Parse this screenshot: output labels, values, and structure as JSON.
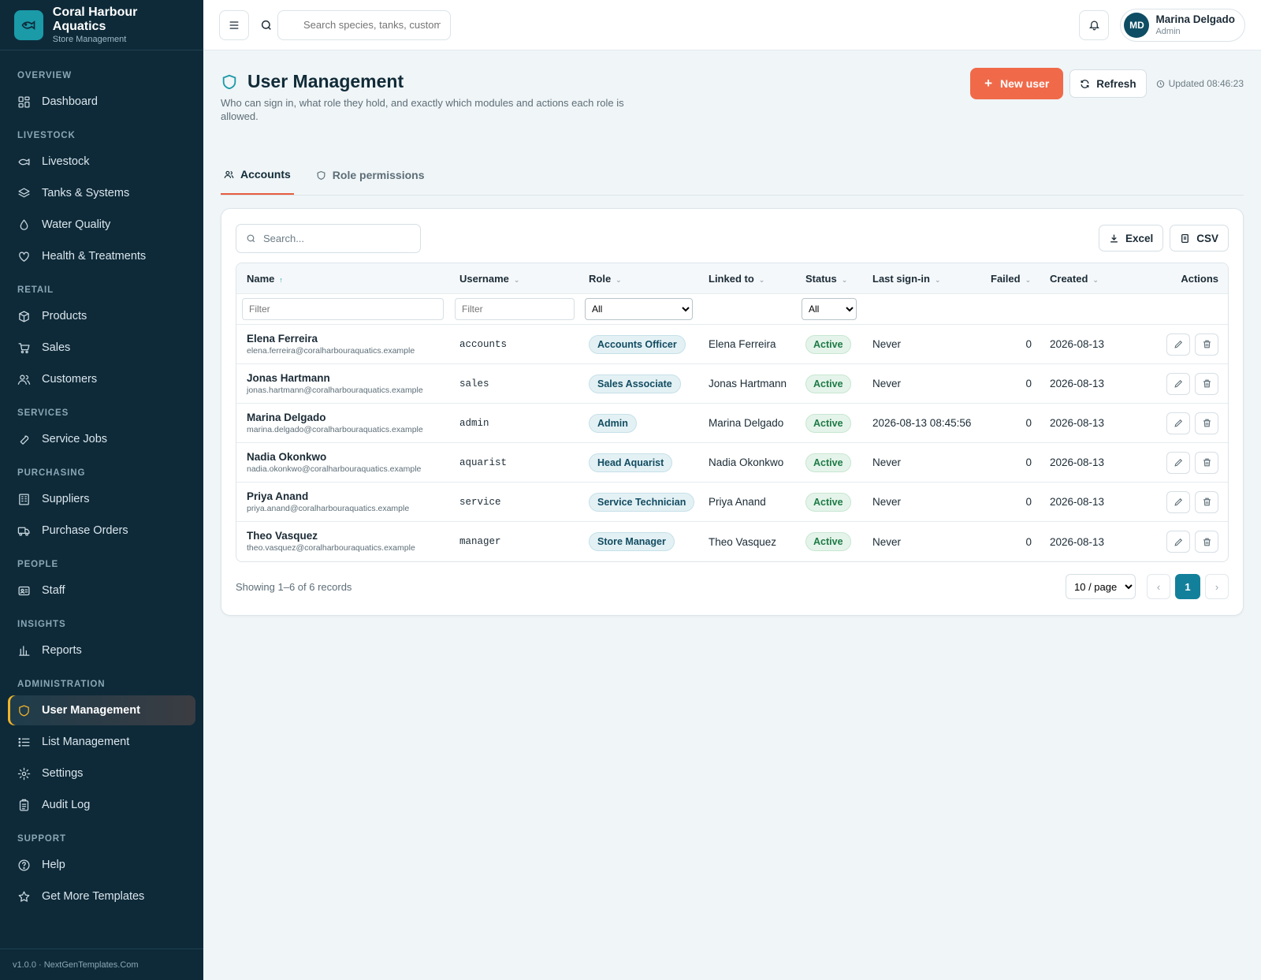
{
  "brand": {
    "title": "Coral Harbour Aquatics",
    "subtitle": "Store Management"
  },
  "sidebar": {
    "sections": [
      {
        "label": "OVERVIEW",
        "items": [
          {
            "label": "Dashboard",
            "icon": "dashboard-icon"
          }
        ]
      },
      {
        "label": "LIVESTOCK",
        "items": [
          {
            "label": "Livestock",
            "icon": "fish-icon"
          },
          {
            "label": "Tanks & Systems",
            "icon": "layers-icon"
          },
          {
            "label": "Water Quality",
            "icon": "droplet-icon"
          },
          {
            "label": "Health & Treatments",
            "icon": "heart-icon"
          }
        ]
      },
      {
        "label": "RETAIL",
        "items": [
          {
            "label": "Products",
            "icon": "box-icon"
          },
          {
            "label": "Sales",
            "icon": "cart-icon"
          },
          {
            "label": "Customers",
            "icon": "users-icon"
          }
        ]
      },
      {
        "label": "SERVICES",
        "items": [
          {
            "label": "Service Jobs",
            "icon": "wrench-icon"
          }
        ]
      },
      {
        "label": "PURCHASING",
        "items": [
          {
            "label": "Suppliers",
            "icon": "building-icon"
          },
          {
            "label": "Purchase Orders",
            "icon": "truck-icon"
          }
        ]
      },
      {
        "label": "PEOPLE",
        "items": [
          {
            "label": "Staff",
            "icon": "id-card-icon"
          }
        ]
      },
      {
        "label": "INSIGHTS",
        "items": [
          {
            "label": "Reports",
            "icon": "bar-chart-icon"
          }
        ]
      },
      {
        "label": "ADMINISTRATION",
        "items": [
          {
            "label": "User Management",
            "icon": "shield-icon",
            "active": true
          },
          {
            "label": "List Management",
            "icon": "list-icon"
          },
          {
            "label": "Settings",
            "icon": "gear-icon"
          },
          {
            "label": "Audit Log",
            "icon": "clipboard-icon"
          }
        ]
      },
      {
        "label": "SUPPORT",
        "items": [
          {
            "label": "Help",
            "icon": "help-icon"
          },
          {
            "label": "Get More Templates",
            "icon": "star-icon"
          }
        ]
      }
    ],
    "footer": "v1.0.0 · NextGenTemplates.Com"
  },
  "topbar": {
    "search_placeholder": "Search species, tanks, customers...",
    "user": {
      "initials": "MD",
      "name": "Marina Delgado",
      "role": "Admin"
    }
  },
  "page": {
    "title": "User Management",
    "description": "Who can sign in, what role they hold, and exactly which modules and actions each role is allowed.",
    "new_user": "New user",
    "refresh": "Refresh",
    "updated": "Updated 08:46:23"
  },
  "tabs": [
    {
      "label": "Accounts",
      "active": true
    },
    {
      "label": "Role permissions",
      "active": false
    }
  ],
  "table": {
    "search_placeholder": "Search...",
    "excel": "Excel",
    "csv": "CSV",
    "headers": {
      "name": "Name",
      "username": "Username",
      "role": "Role",
      "linked": "Linked to",
      "status": "Status",
      "last_signin": "Last sign-in",
      "failed": "Failed",
      "created": "Created",
      "actions": "Actions"
    },
    "filter_placeholder": "Filter",
    "filter_all": "All",
    "rows": [
      {
        "name": "Elena Ferreira",
        "email": "elena.ferreira@coralharbouraquatics.example",
        "username": "accounts",
        "role": "Accounts Officer",
        "linked": "Elena Ferreira",
        "status": "Active",
        "last_signin": "Never",
        "failed": "0",
        "created": "2026-08-13"
      },
      {
        "name": "Jonas Hartmann",
        "email": "jonas.hartmann@coralharbouraquatics.example",
        "username": "sales",
        "role": "Sales Associate",
        "linked": "Jonas Hartmann",
        "status": "Active",
        "last_signin": "Never",
        "failed": "0",
        "created": "2026-08-13"
      },
      {
        "name": "Marina Delgado",
        "email": "marina.delgado@coralharbouraquatics.example",
        "username": "admin",
        "role": "Admin",
        "linked": "Marina Delgado",
        "status": "Active",
        "last_signin": "2026-08-13 08:45:56",
        "failed": "0",
        "created": "2026-08-13"
      },
      {
        "name": "Nadia Okonkwo",
        "email": "nadia.okonkwo@coralharbouraquatics.example",
        "username": "aquarist",
        "role": "Head Aquarist",
        "linked": "Nadia Okonkwo",
        "status": "Active",
        "last_signin": "Never",
        "failed": "0",
        "created": "2026-08-13"
      },
      {
        "name": "Priya Anand",
        "email": "priya.anand@coralharbouraquatics.example",
        "username": "service",
        "role": "Service Technician",
        "linked": "Priya Anand",
        "status": "Active",
        "last_signin": "Never",
        "failed": "0",
        "created": "2026-08-13"
      },
      {
        "name": "Theo Vasquez",
        "email": "theo.vasquez@coralharbouraquatics.example",
        "username": "manager",
        "role": "Store Manager",
        "linked": "Theo Vasquez",
        "status": "Active",
        "last_signin": "Never",
        "failed": "0",
        "created": "2026-08-13"
      }
    ],
    "showing": "Showing 1–6 of 6 records",
    "page_size": "10 / page",
    "current_page": "1",
    "prev": "‹",
    "next": "›"
  },
  "colors": {
    "sidebar_bg": "#0e2a39",
    "accent": "#1b9aa8",
    "primary_button": "#f06a4a",
    "active_highlight": "#f0b429",
    "status_active": "#1d7a45"
  }
}
